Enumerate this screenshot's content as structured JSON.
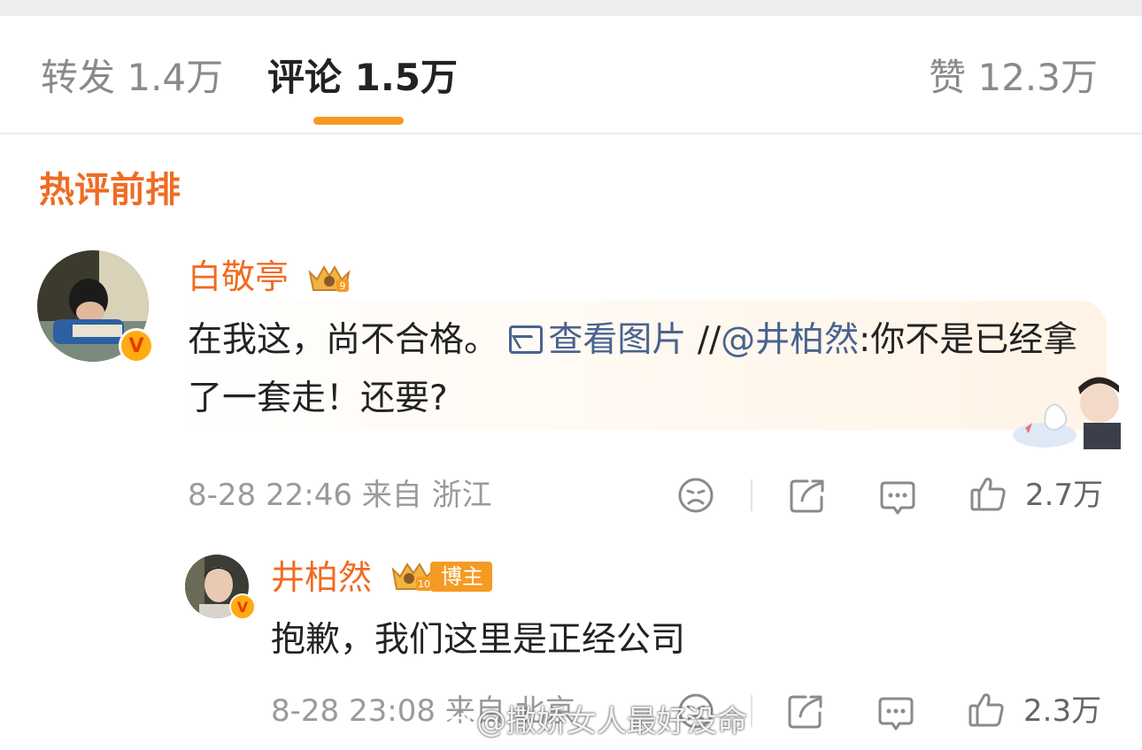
{
  "tabs": {
    "repost": "转发 1.4万",
    "comment": "评论 1.5万",
    "like": "赞 12.3万"
  },
  "section_title": "热评前排",
  "comment": {
    "username": "白敬亭",
    "badge_level": "9",
    "text_main": "在我这，尚不合格。",
    "view_image": "查看图片",
    "repost_prefix": "//",
    "mention": "@井柏然",
    "text_after": ":你不是已经拿了一套走！还要?",
    "meta": "8-28 22:46 来自 浙江",
    "likes": "2.7万"
  },
  "reply": {
    "username": "井柏然",
    "badge_level": "10",
    "tag": "博主",
    "text": "抱歉，我们这里是正经公司",
    "meta": "8-28 23:08 来自 北京",
    "likes": "2.3万"
  },
  "watermark": "@撒娇女人最好没命",
  "icons": [
    "sad-face-icon",
    "share-icon",
    "comment-icon",
    "thumbs-up-icon",
    "image-icon",
    "verified-v-icon",
    "crown-badge-icon"
  ],
  "colors": {
    "accent": "#f06b23",
    "tab_underline": "#f49a24",
    "link": "#48638f",
    "verified": "#ffab12"
  }
}
